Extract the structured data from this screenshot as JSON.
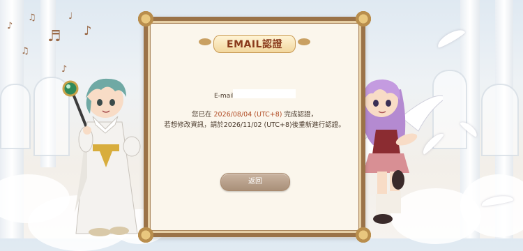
{
  "dialog": {
    "title": "EMAIL認證",
    "email_label": "E-mail：",
    "email_value": "",
    "msg1_prefix": "您已在 ",
    "msg1_date": "2026/08/04 (UTC+8)",
    "msg1_suffix": " 完成認證，",
    "msg2": "若想修改資訊，請於2026/11/02 (UTC+8)後重新進行認證。",
    "back_label": "返回"
  },
  "decor": {
    "notes": [
      "♪",
      "♫",
      "♬",
      "♩",
      "♪",
      "♫",
      "♪"
    ]
  },
  "colors": {
    "frame": "#9b7348",
    "panel": "#fbf6ec",
    "highlight": "#b04a22",
    "button": "#b39c87"
  }
}
